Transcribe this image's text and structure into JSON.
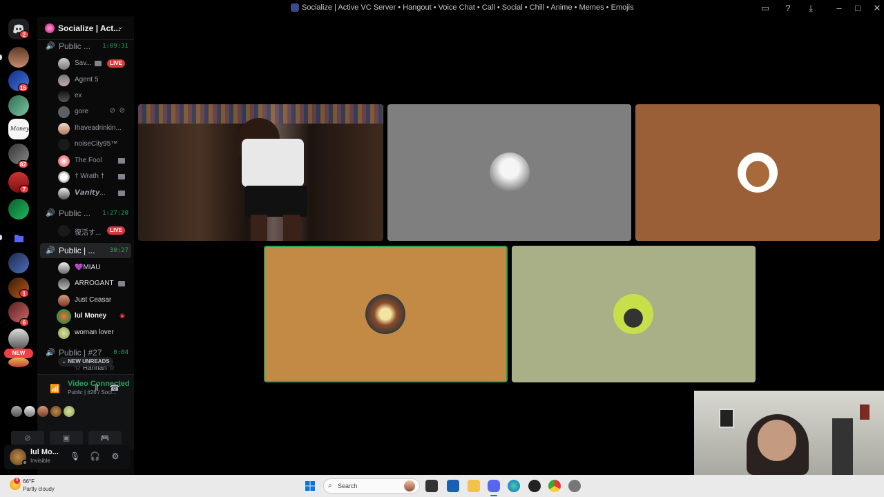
{
  "window": {
    "title": "Socialize | Active VC Server • Hangout • Voice Chat • Call • Social • Chill • Anime • Memes • Emojis"
  },
  "rail": {
    "badges": [
      "2",
      "15",
      "82",
      "7",
      "1",
      "6"
    ],
    "new_label": "NEW",
    "money_label": "Money"
  },
  "server": {
    "name": "Socialize | Act..."
  },
  "channels": [
    {
      "name": "Public ...",
      "timer": "1:09:31",
      "users": [
        {
          "name": "Sav...",
          "live": true,
          "live_label": "LIVE"
        },
        {
          "name": "Agent 5"
        },
        {
          "name": "ex"
        },
        {
          "name": "gore"
        },
        {
          "name": "Ihaveadrinkin..."
        },
        {
          "name": "noiseCity95™"
        },
        {
          "name": "The Fool"
        },
        {
          "name": "† Wrath †"
        },
        {
          "name": "𝙑𝙖𝙣𝙞𝙩𝙮..."
        }
      ]
    },
    {
      "name": "Public ...",
      "timer": "1:27:20",
      "users": [
        {
          "name": "復活す...",
          "live": true,
          "live_label": "LIVE"
        }
      ]
    },
    {
      "name": "Public | ...",
      "timer": "30:27",
      "users": [
        {
          "name": "💜MIAU"
        },
        {
          "name": "ARROGANT"
        },
        {
          "name": "Just Ceasar"
        },
        {
          "name": "lul Money"
        },
        {
          "name": "woman lover"
        }
      ]
    },
    {
      "name": "Public | #27",
      "timer": "0:04",
      "users": [
        {
          "name": "☆ Hannah ☆"
        }
      ]
    }
  ],
  "new_unreads": "NEW UNREADS",
  "voice": {
    "status": "Video Connected",
    "channel": "Public | #26 / Soci..."
  },
  "user": {
    "name": "lul Mo...",
    "status": "Invisible"
  },
  "taskbar": {
    "weather_temp": "66°F",
    "weather_desc": "Partly cloudy",
    "search_label": "Search"
  },
  "colors": {
    "accent_green": "#23a55a",
    "live_red": "#da373c",
    "tile_gray": "#7f7f7f",
    "tile_brown": "#9a5f36",
    "tile_orange": "#c38a45",
    "tile_sage": "#a9b088"
  }
}
